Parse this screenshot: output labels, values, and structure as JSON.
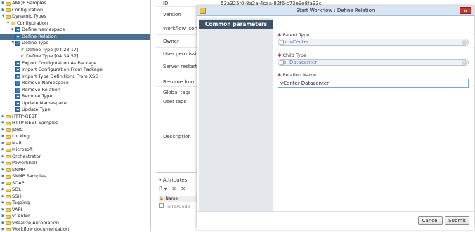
{
  "tree": [
    {
      "label": "AMQP Samples",
      "kind": "folder",
      "level": 0,
      "arrow": "right"
    },
    {
      "label": "Configuration",
      "kind": "folder",
      "level": 0,
      "arrow": "right"
    },
    {
      "label": "Dynamic Types",
      "kind": "folder",
      "level": 0,
      "arrow": "down"
    },
    {
      "label": "Configuration",
      "kind": "folder",
      "level": 1,
      "arrow": "down"
    },
    {
      "label": "Define Namespace",
      "kind": "workflow",
      "level": 2,
      "arrow": "right"
    },
    {
      "label": "Define Relation",
      "kind": "workflow",
      "level": 2,
      "arrow": "",
      "selected": true
    },
    {
      "label": "Define Type",
      "kind": "workflow",
      "level": 2,
      "arrow": "down"
    },
    {
      "label": "Define Type [04:23:17]",
      "kind": "check",
      "level": 3,
      "arrow": ""
    },
    {
      "label": "Define Type [04:34:57]",
      "kind": "check",
      "level": 3,
      "arrow": ""
    },
    {
      "label": "Export Configuration As Package",
      "kind": "workflow",
      "level": 2,
      "arrow": ""
    },
    {
      "label": "Import Configuration From Package",
      "kind": "workflow",
      "level": 2,
      "arrow": ""
    },
    {
      "label": "Import Type Definitions From XSD",
      "kind": "workflow",
      "level": 2,
      "arrow": ""
    },
    {
      "label": "Remove Namespace",
      "kind": "workflow",
      "level": 2,
      "arrow": ""
    },
    {
      "label": "Remove Relation",
      "kind": "workflow",
      "level": 2,
      "arrow": ""
    },
    {
      "label": "Remove Type",
      "kind": "workflow",
      "level": 2,
      "arrow": ""
    },
    {
      "label": "Update Namespace",
      "kind": "workflow",
      "level": 2,
      "arrow": ""
    },
    {
      "label": "Update Type",
      "kind": "workflow",
      "level": 2,
      "arrow": ""
    },
    {
      "label": "HTTP-REST",
      "kind": "folder",
      "level": 0,
      "arrow": "right"
    },
    {
      "label": "HTTP-REST Samples",
      "kind": "folder",
      "level": 0,
      "arrow": "right"
    },
    {
      "label": "JDBC",
      "kind": "folder",
      "level": 0,
      "arrow": "right"
    },
    {
      "label": "Locking",
      "kind": "folder",
      "level": 0,
      "arrow": "right"
    },
    {
      "label": "Mail",
      "kind": "folder",
      "level": 0,
      "arrow": "right"
    },
    {
      "label": "Microsoft",
      "kind": "folder",
      "level": 0,
      "arrow": "right"
    },
    {
      "label": "Orchestrator",
      "kind": "folder",
      "level": 0,
      "arrow": "right"
    },
    {
      "label": "PowerShell",
      "kind": "folder",
      "level": 0,
      "arrow": "right"
    },
    {
      "label": "SNMP",
      "kind": "folder",
      "level": 0,
      "arrow": "right"
    },
    {
      "label": "SNMP Samples",
      "kind": "folder",
      "level": 0,
      "arrow": "right"
    },
    {
      "label": "SOAP",
      "kind": "folder",
      "level": 0,
      "arrow": "right"
    },
    {
      "label": "SQL",
      "kind": "folder",
      "level": 0,
      "arrow": "right"
    },
    {
      "label": "SSH",
      "kind": "folder",
      "level": 0,
      "arrow": "right"
    },
    {
      "label": "Tagging",
      "kind": "folder",
      "level": 0,
      "arrow": "right"
    },
    {
      "label": "VAPI",
      "kind": "folder",
      "level": 0,
      "arrow": "right"
    },
    {
      "label": "vCenter",
      "kind": "folder",
      "level": 0,
      "arrow": "right"
    },
    {
      "label": "vRealize Automation",
      "kind": "folder",
      "level": 0,
      "arrow": "right"
    },
    {
      "label": "Workflow documentation",
      "kind": "folder",
      "level": 0,
      "arrow": "right"
    }
  ],
  "props": {
    "id_label": "ID",
    "id_value": "53a325f0-8a2a-4caa-82f6-c73e9e8fa93c",
    "version_label": "Version",
    "workflow_icon_label": "Workflow icon",
    "owner_label": "Owner",
    "user_permission_label": "User permission",
    "server_restart_label": "Server restart be",
    "resume_label": "Resume from fa",
    "global_tags_label": "Global tags",
    "user_tags_label": "User tags",
    "description_label": "Description"
  },
  "attributes": {
    "title": "Attributes",
    "toolbar": "R▾ ✕ ✕",
    "col_name": "Name",
    "row1": "errorCode"
  },
  "dialog": {
    "title": "Start Workflow : Define Relation",
    "close": "✕",
    "nav_item": "Common parameters",
    "parent_type_label": "Parent Type",
    "parent_type_value": "vCenter",
    "child_type_label": "Child Type",
    "child_type_value": "Datacenter",
    "relation_name_label": "Relation Name",
    "relation_name_value": "vCenter-Datacenter",
    "cancel": "Cancel",
    "submit": "Submit"
  },
  "colors": {
    "selection": "#4a6f8f",
    "nav_active": "#3d5266",
    "close_button": "#c8372d",
    "required_marker": "#c0392b",
    "chip_text": "#5a7fae"
  }
}
